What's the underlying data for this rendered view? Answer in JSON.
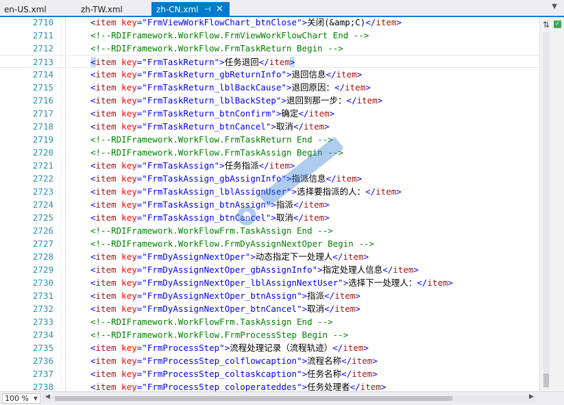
{
  "tabs": [
    {
      "label": "en-US.xml"
    },
    {
      "label": "zh-TW.xml"
    },
    {
      "label": "zh-CN.xml",
      "active": true
    }
  ],
  "icons": {
    "pin": "pin-icon",
    "close": "close-icon",
    "dropdown": "chevron-down-icon",
    "split": "split-icon",
    "check": "check-icon"
  },
  "colors": {
    "accent": "#007acc",
    "line_number": "#2b91af",
    "tag": "#0000ff",
    "attr_value": "#a31515",
    "attr_name": "#ff0000",
    "comment": "#008000"
  },
  "editor": {
    "lines": [
      {
        "n": "2710",
        "kind": "item",
        "key": "FrmViewWorkFlowChart_btnClose",
        "text": "关闭(&amp;C)"
      },
      {
        "n": "2711",
        "kind": "comment",
        "text": "<!--RDIFramework.WorkFlow.FrmViewWorkFlowChart End -->"
      },
      {
        "n": "2712",
        "kind": "comment",
        "text": "<!--RDIFramework.WorkFlow.FrmTaskReturn Begin -->"
      },
      {
        "n": "2713",
        "kind": "item",
        "key": "FrmTaskReturn",
        "text": "任务退回",
        "current": true
      },
      {
        "n": "2714",
        "kind": "item",
        "key": "FrmTaskReturn_gbReturnInfo",
        "text": "退回信息"
      },
      {
        "n": "2715",
        "kind": "item",
        "key": "FrmTaskReturn_lblBackCause",
        "text": "退回原因："
      },
      {
        "n": "2716",
        "kind": "item",
        "key": "FrmTaskReturn_lblBackStep",
        "text": "退回到那一步："
      },
      {
        "n": "2717",
        "kind": "item",
        "key": "FrmTaskReturn_btnConfirm",
        "text": "确定"
      },
      {
        "n": "2718",
        "kind": "item",
        "key": "FrmTaskReturn_btnCancel",
        "text": "取消"
      },
      {
        "n": "2719",
        "kind": "comment",
        "text": "<!--RDIFramework.WorkFlow.FrmTaskReturn End -->"
      },
      {
        "n": "2720",
        "kind": "comment",
        "text": "<!--RDIFramework.WorkFlow.FrmTaskAssign Begin -->"
      },
      {
        "n": "2721",
        "kind": "item",
        "key": "FrmTaskAssign",
        "text": "任务指派"
      },
      {
        "n": "2722",
        "kind": "item",
        "key": "FrmTaskAssign_gbAssignInfo",
        "text": "指派信息"
      },
      {
        "n": "2723",
        "kind": "item",
        "key": "FrmTaskAssign_lblAssignUser",
        "text": "选择要指派的人："
      },
      {
        "n": "2724",
        "kind": "item",
        "key": "FrmTaskAssign_btnAssign",
        "text": "指派"
      },
      {
        "n": "2725",
        "kind": "item",
        "key": "FrmTaskAssign_btnCancel",
        "text": "取消"
      },
      {
        "n": "2726",
        "kind": "comment",
        "text": "<!--RDIFramework.WorkFlowFrm.TaskAssign End -->"
      },
      {
        "n": "2727",
        "kind": "comment",
        "text": "<!--RDIFramework.WorkFlow.FrmDyAssignNextOper Begin -->"
      },
      {
        "n": "2728",
        "kind": "item",
        "key": "FrmDyAssignNextOper",
        "text": "动态指定下一处理人"
      },
      {
        "n": "2729",
        "kind": "item",
        "key": "FrmDyAssignNextOper_gbAssignInfo",
        "text": "指定处理人信息"
      },
      {
        "n": "2730",
        "kind": "item",
        "key": "FrmDyAssignNextOper_lblAssignNextUser",
        "text": "选择下一处理人："
      },
      {
        "n": "2731",
        "kind": "item",
        "key": "FrmDyAssignNextOper_btnAssign",
        "text": "指派"
      },
      {
        "n": "2732",
        "kind": "item",
        "key": "FrmDyAssignNextOper_btnCancel",
        "text": "取消"
      },
      {
        "n": "2733",
        "kind": "comment",
        "text": "<!--RDIFramework.WorkFlowFrm.TaskAssign End -->"
      },
      {
        "n": "2734",
        "kind": "comment",
        "text": "<!--RDIFramework.WorkFlow.FrmProcessStep Begin -->"
      },
      {
        "n": "2735",
        "kind": "item",
        "key": "FrmProcessStep",
        "text": "流程处理记录（流程轨迹）"
      },
      {
        "n": "2736",
        "kind": "item",
        "key": "FrmProcessStep_colflowcaption",
        "text": "流程名称"
      },
      {
        "n": "2737",
        "kind": "item",
        "key": "FrmProcessStep_coltaskcaption",
        "text": "任务名称"
      },
      {
        "n": "2738",
        "kind": "item",
        "key": "FrmProcessStep_coloperateddes",
        "text": "任务处理者"
      }
    ]
  },
  "status": {
    "zoom": "100 %"
  }
}
